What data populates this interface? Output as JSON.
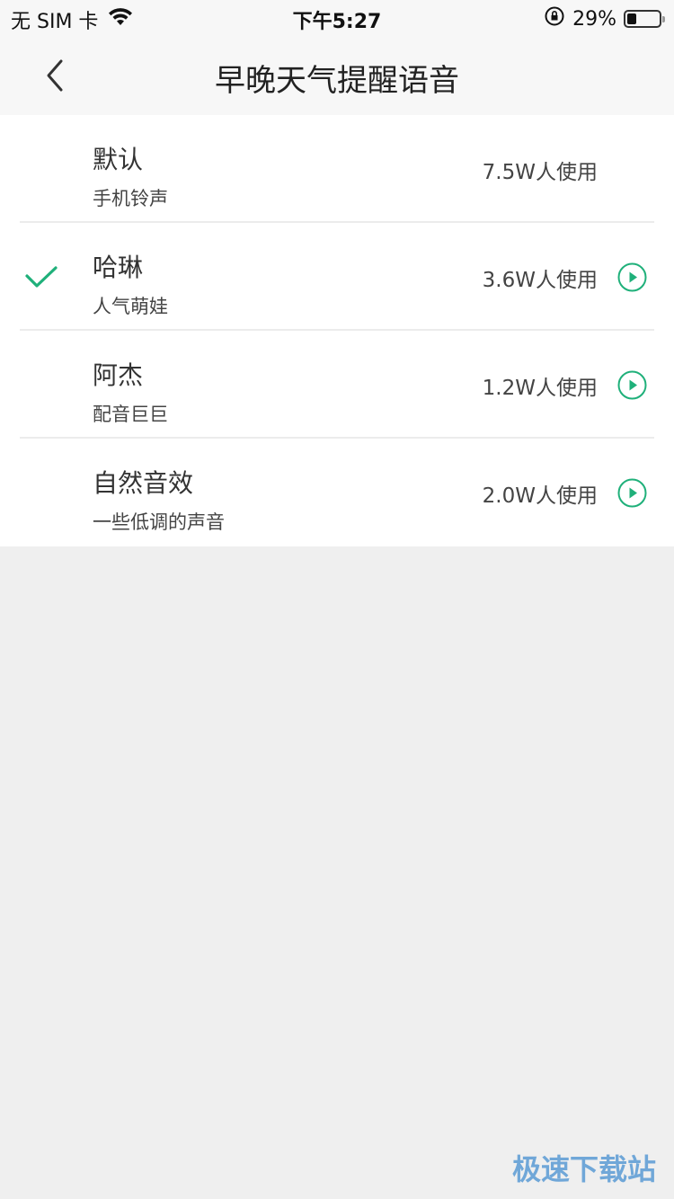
{
  "status_bar": {
    "carrier": "无 SIM 卡",
    "time": "下午5:27",
    "battery_percent": "29%",
    "battery_level": 0.29,
    "icons": [
      "wifi-icon",
      "orientation-lock-icon",
      "battery-icon"
    ]
  },
  "nav": {
    "title": "早晚天气提醒语音",
    "back_icon": "chevron-left-icon"
  },
  "voices": [
    {
      "name": "默认",
      "subtitle": "手机铃声",
      "usage": "7.5W人使用",
      "selected": false,
      "has_preview": false
    },
    {
      "name": "哈琳",
      "subtitle": "人气萌娃",
      "usage": "3.6W人使用",
      "selected": true,
      "has_preview": true
    },
    {
      "name": "阿杰",
      "subtitle": "配音巨巨",
      "usage": "1.2W人使用",
      "selected": false,
      "has_preview": true
    },
    {
      "name": "自然音效",
      "subtitle": "一些低调的声音",
      "usage": "2.0W人使用",
      "selected": false,
      "has_preview": true
    }
  ],
  "colors": {
    "accent": "#1fb07a",
    "background": "#efefef",
    "nav_background": "#f7f7f7"
  },
  "watermark": "极速下载站"
}
